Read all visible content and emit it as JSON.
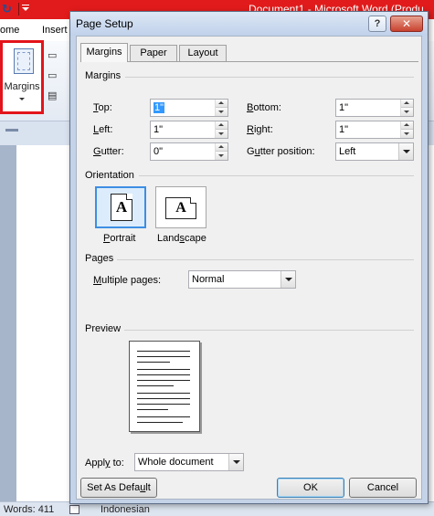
{
  "word": {
    "title": "Document1 - Microsoft Word (Produ",
    "tabs": {
      "home": "ome",
      "insert": "Insert"
    },
    "ribbon": {
      "margins_label": "Margins"
    },
    "status": {
      "words": "Words: 411",
      "language": "Indonesian"
    }
  },
  "dialog": {
    "title": "Page Setup",
    "help_label": "?",
    "close_label": "✕",
    "tabs": [
      "Margins",
      "Paper",
      "Layout"
    ],
    "margins_section": "Margins",
    "fields": {
      "top": {
        "label": "Top:",
        "value": "1\""
      },
      "bottom": {
        "label": "Bottom:",
        "value": "1\""
      },
      "left": {
        "label": "Left:",
        "value": "1\""
      },
      "right": {
        "label": "Right:",
        "value": "1\""
      },
      "gutter": {
        "label": "Gutter:",
        "value": "0\""
      },
      "gutter_position": {
        "label": "Gutter position:",
        "value": "Left"
      }
    },
    "orientation": {
      "section": "Orientation",
      "portrait": "Portrait",
      "landscape": "Landscape",
      "icon_letter": "A",
      "selected": "portrait"
    },
    "pages": {
      "section": "Pages",
      "multiple_label": "Multiple pages:",
      "multiple_value": "Normal"
    },
    "preview": {
      "section": "Preview"
    },
    "apply": {
      "label": "Apply to:",
      "value": "Whole document"
    },
    "buttons": {
      "set_default": "Set As Default",
      "ok": "OK",
      "cancel": "Cancel"
    }
  },
  "colors": {
    "title_red": "#e11b1b",
    "highlight_red": "#e3141b",
    "selection_blue": "#3399ff",
    "orientation_selected": "#3d8ee3"
  }
}
